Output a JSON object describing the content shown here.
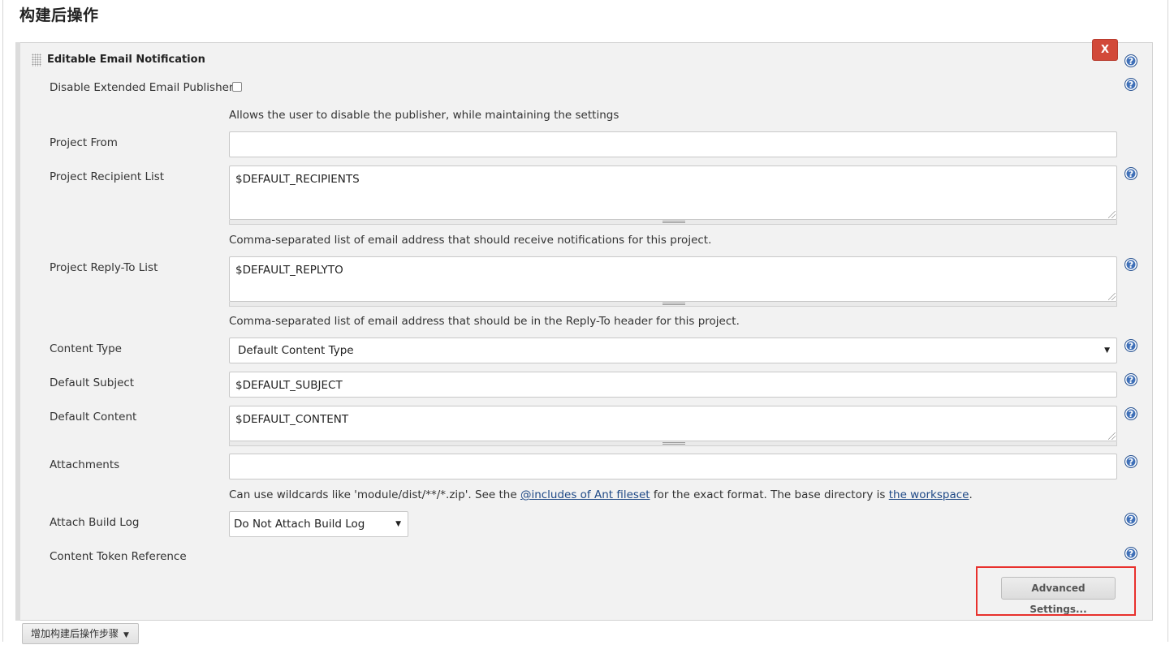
{
  "section_title": "构建后操作",
  "panel": {
    "title": "Editable Email Notification",
    "delete_label": "X",
    "help_glyph": "?"
  },
  "fields": {
    "disable_publisher": {
      "label": "Disable Extended Email Publisher",
      "checked": false,
      "description": "Allows the user to disable the publisher, while maintaining the settings"
    },
    "project_from": {
      "label": "Project From",
      "value": ""
    },
    "recipient_list": {
      "label": "Project Recipient List",
      "value": "$DEFAULT_RECIPIENTS",
      "description": "Comma-separated list of email address that should receive notifications for this project."
    },
    "reply_to_list": {
      "label": "Project Reply-To List",
      "value": "$DEFAULT_REPLYTO",
      "description": "Comma-separated list of email address that should be in the Reply-To header for this project."
    },
    "content_type": {
      "label": "Content Type",
      "selected": "Default Content Type"
    },
    "default_subject": {
      "label": "Default Subject",
      "value": "$DEFAULT_SUBJECT"
    },
    "default_content": {
      "label": "Default Content",
      "value": "$DEFAULT_CONTENT"
    },
    "attachments": {
      "label": "Attachments",
      "value": "",
      "description_prefix": "Can use wildcards like 'module/dist/**/*.zip'. See the ",
      "link1": "@includes of Ant fileset",
      "description_middle": " for the exact format. The base directory is ",
      "link2": "the workspace",
      "description_suffix": "."
    },
    "attach_build_log": {
      "label": "Attach Build Log",
      "selected": "Do Not Attach Build Log"
    },
    "content_token_reference": {
      "label": "Content Token Reference"
    }
  },
  "buttons": {
    "advanced_settings": "Advanced Settings...",
    "add_post_build_step": "增加构建后操作步骤"
  },
  "colors": {
    "delete_button": "#d24939",
    "help_icon": "#3f70b8",
    "highlight_box": "#e8312d",
    "link": "#204a87"
  },
  "icons": [
    "drag-handle-icon",
    "help-icon",
    "dropdown-caret-icon",
    "resize-grip-icon"
  ]
}
